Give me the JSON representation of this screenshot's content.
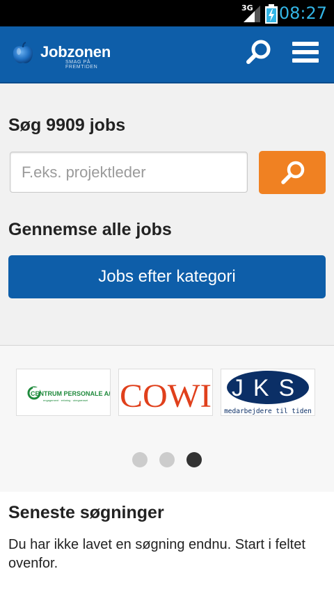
{
  "status_bar": {
    "network": "3G",
    "time": "08:27"
  },
  "app_bar": {
    "brand": "Jobzonen",
    "tagline": "SMAG PÅ FREMTIDEN"
  },
  "search": {
    "title": "Søg 9909 jobs",
    "placeholder": "F.eks. projektleder"
  },
  "browse": {
    "title": "Gennemse alle jobs",
    "category_button": "Jobs efter kategori"
  },
  "carousel": {
    "logos": [
      {
        "name": "CENTRUM PERSONALE A/S",
        "sub": "engagement · erfaring · ubegrænset"
      },
      {
        "name": "COWI"
      },
      {
        "name": "JKS",
        "sub": "medarbejdere til tiden"
      }
    ],
    "active_page": 3,
    "page_count": 3
  },
  "recent": {
    "title": "Seneste søgninger",
    "empty_text": "Du har ikke lavet en søgning endnu. Start i feltet ovenfor."
  },
  "colors": {
    "brand_blue": "#0e5ea9",
    "accent_orange": "#f08122",
    "status_blue": "#33b5e5"
  }
}
